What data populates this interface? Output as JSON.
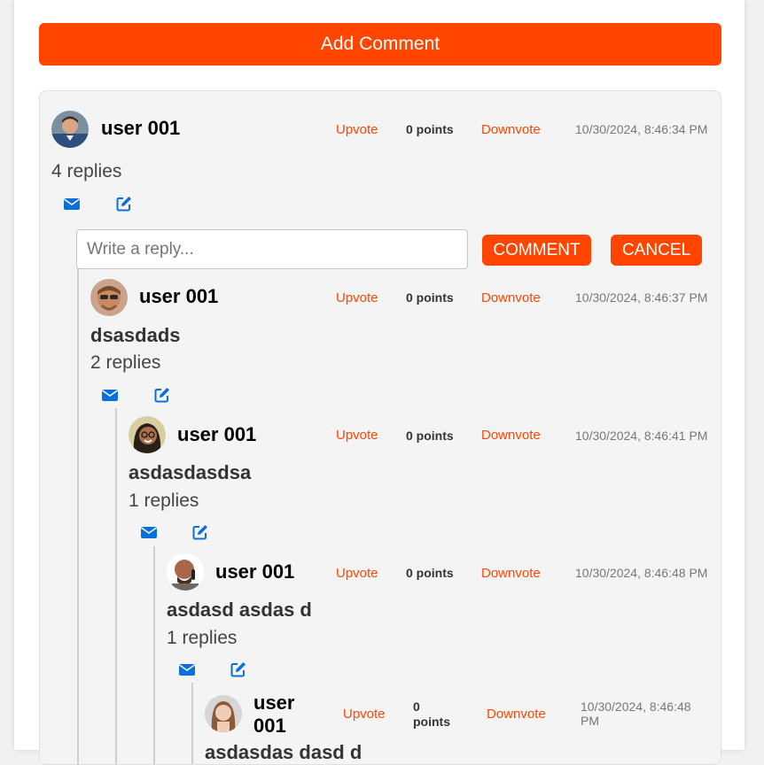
{
  "toolbar": {
    "add_comment_label": "Add Comment"
  },
  "colors": {
    "accent": "#ff4500",
    "icon_blue": "#0a6fd8",
    "card_bg": "#f4f4f4"
  },
  "reply_form": {
    "placeholder": "Write a reply...",
    "value": "",
    "comment_label": "COMMENT",
    "cancel_label": "CANCEL"
  },
  "comments": [
    {
      "user": "user 001",
      "upvote": "Upvote",
      "points": "0 points",
      "downvote": "Downvote",
      "timestamp": "10/30/2024, 8:46:34 PM",
      "text": "",
      "replies": "4 replies",
      "avatar": "avatar-man-blue-shirt"
    },
    {
      "user": "user 001",
      "upvote": "Upvote",
      "points": "0 points",
      "downvote": "Downvote",
      "timestamp": "10/30/2024, 8:46:37 PM",
      "text": "dsasdads",
      "replies": "2 replies",
      "avatar": "avatar-man-sunglasses"
    },
    {
      "user": "user 001",
      "upvote": "Upvote",
      "points": "0 points",
      "downvote": "Downvote",
      "timestamp": "10/30/2024, 8:46:41 PM",
      "text": "asdasdasdsa",
      "replies": "1 replies",
      "avatar": "avatar-woman-glasses"
    },
    {
      "user": "user 001",
      "upvote": "Upvote",
      "points": "0 points",
      "downvote": "Downvote",
      "timestamp": "10/30/2024, 8:46:48 PM",
      "text": "asdasd asdas d",
      "replies": "1 replies",
      "avatar": "avatar-bald-man"
    },
    {
      "user_line1": "user",
      "user_line2": "001",
      "upvote": "Upvote",
      "points_line1": "0",
      "points_line2": "points",
      "downvote": "Downvote",
      "timestamp_line1": "10/30/2024, 8:46:48",
      "timestamp_line2": "PM",
      "text": "asdasdas dasd d",
      "avatar": "avatar-woman-long-hair"
    }
  ],
  "icons": {
    "reply": "envelope-icon",
    "edit": "edit-icon"
  }
}
